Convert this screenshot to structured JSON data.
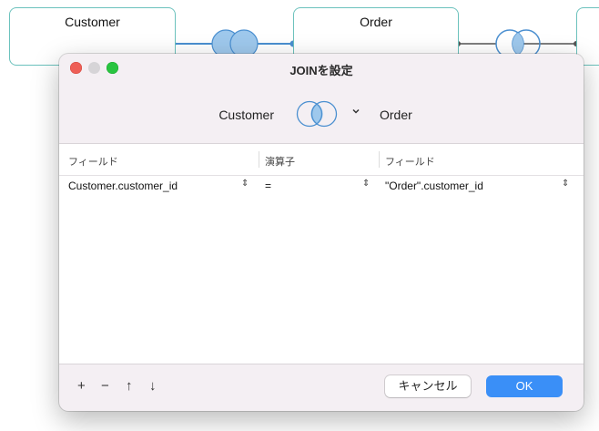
{
  "canvas": {
    "nodes": [
      {
        "name": "Customer"
      },
      {
        "name": "Order"
      }
    ]
  },
  "dialog": {
    "title": "JOINを設定",
    "left_table": "Customer",
    "right_table": "Order",
    "join_icon": "venn-inner-join-icon",
    "chevron": "chevron-down-icon",
    "columns": [
      "フィールド",
      "演算子",
      "フィールド"
    ],
    "rows": [
      {
        "left_field": "Customer.customer_id",
        "operator": "=",
        "right_field": "\"Order\".customer_id"
      }
    ],
    "footer": {
      "add_glyph": "+",
      "remove_glyph": "−",
      "up_glyph": "↑",
      "down_glyph": "↓",
      "cancel_label": "キャンセル",
      "ok_label": "OK"
    }
  },
  "colors": {
    "accent": "#3a8ff7",
    "node_border": "#6cc2bd",
    "venn_fill": "#9ec8ec",
    "venn_stroke": "#4a8fd0",
    "edge": "#555555"
  }
}
